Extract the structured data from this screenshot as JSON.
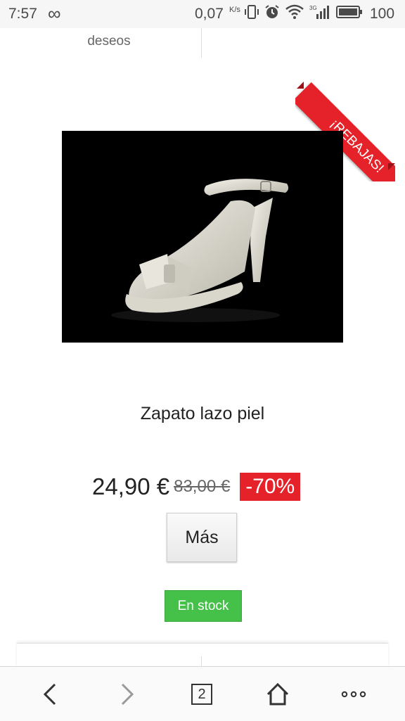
{
  "status_bar": {
    "time": "7:57",
    "network_speed": "0,07",
    "network_unit": "K/s",
    "battery": "100"
  },
  "top_nav": {
    "wishlist_label": "deseos"
  },
  "product": {
    "sale_ribbon": "¡REBAJAS!",
    "name": "Zapato lazo piel",
    "price": "24,90 €",
    "old_price": "83,00 €",
    "discount": "-70%",
    "more_button": "Más",
    "stock_status": "En stock"
  },
  "browser_bar": {
    "tab_count": "2",
    "icons": [
      "back-icon",
      "forward-icon",
      "tabs-icon",
      "home-icon",
      "menu-icon"
    ]
  },
  "colors": {
    "sale_red": "#e52229",
    "stock_green": "#45c14a"
  }
}
